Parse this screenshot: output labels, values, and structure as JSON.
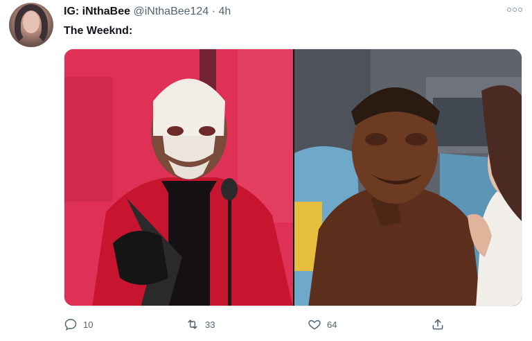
{
  "tweet": {
    "author_name": "IG: iNthaBee",
    "handle": "@iNthaBee124",
    "separator": "·",
    "time": "4h",
    "text": "The Weeknd:",
    "more_icon": "more-options-icon"
  },
  "actions": {
    "replies": "10",
    "retweets": "33",
    "likes": "64"
  },
  "icons": {
    "reply": "reply-icon",
    "retweet": "retweet-icon",
    "like": "heart-icon",
    "share": "share-icon"
  },
  "colors": {
    "text_primary": "#0f1419",
    "text_secondary": "#536471"
  }
}
